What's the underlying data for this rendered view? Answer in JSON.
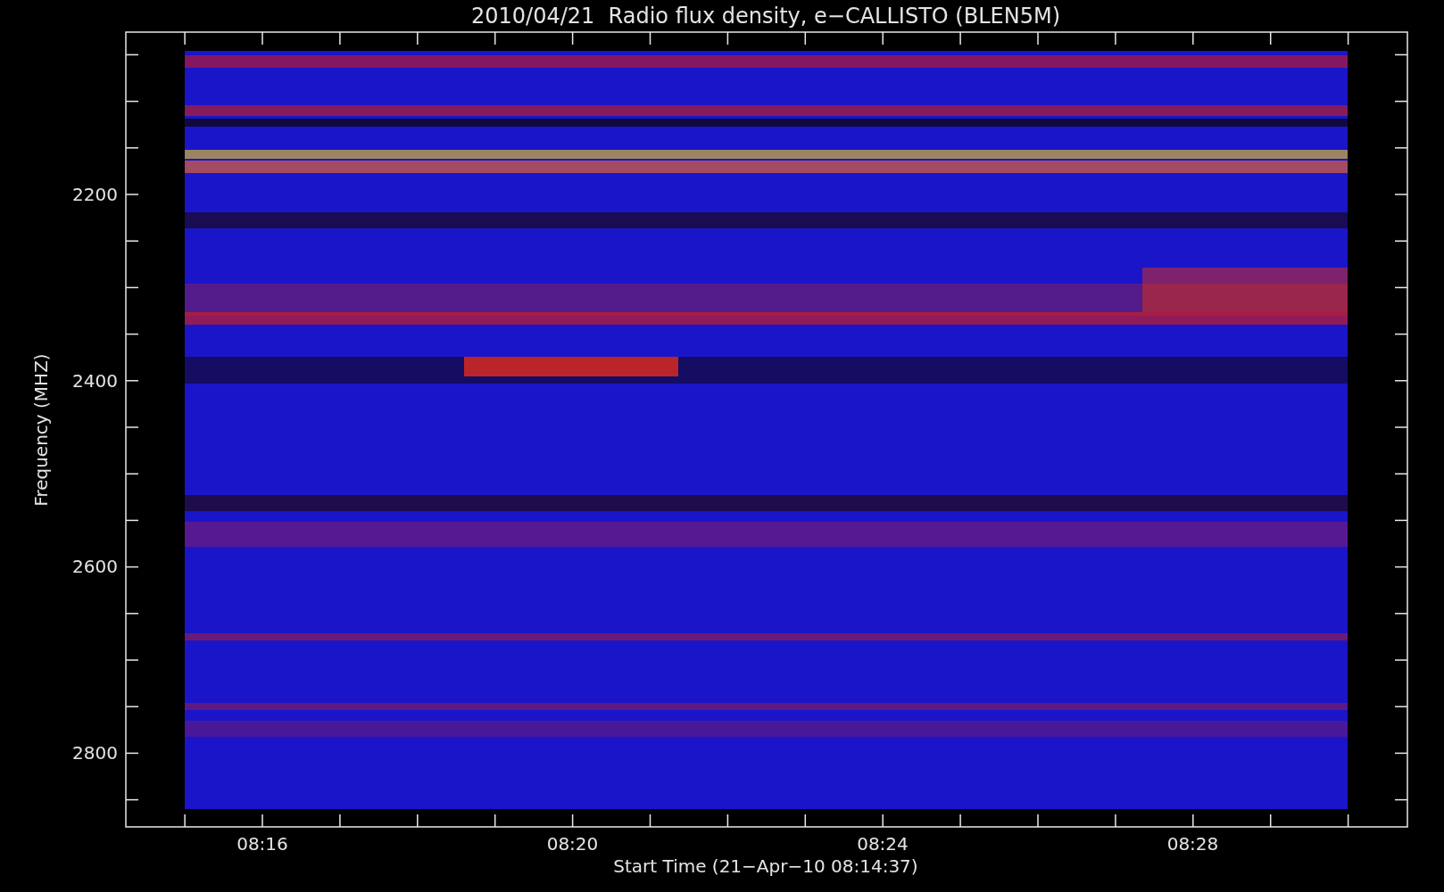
{
  "title": "2010/04/21  Radio flux density, e−CALLISTO (BLEN5M)",
  "y_axis": {
    "label": "Frequency (MHZ)",
    "ticks": [
      "2200",
      "2400",
      "2600",
      "2800"
    ]
  },
  "x_axis": {
    "label": "Start Time (21−Apr−10 08:14:37)",
    "ticks": [
      "08:16",
      "08:20",
      "08:24",
      "08:28"
    ]
  }
}
